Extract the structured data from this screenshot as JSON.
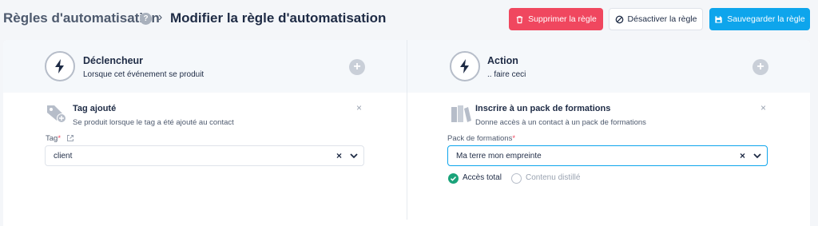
{
  "header": {
    "breadcrumb_parent": "Règles d'automatisation",
    "help_icon_label": "?",
    "page_title": "Modifier la règle d'automatisation",
    "buttons": {
      "delete": "Supprimer la règle",
      "deactivate": "Désactiver la règle",
      "save": "Sauvegarder la règle"
    }
  },
  "trigger": {
    "title": "Déclencheur",
    "subtitle": "Lorsque cet événement se produit",
    "item": {
      "title": "Tag ajouté",
      "subtitle": "Se produit lorsque le tag a été ajouté au contact",
      "field_label": "Tag",
      "field_value": "client"
    }
  },
  "action": {
    "title": "Action",
    "subtitle": ".. faire ceci",
    "item": {
      "title": "Inscrire à un pack de formations",
      "subtitle": "Donne accès à un contact à un pack de formations",
      "field_label": "Pack de formations",
      "field_value": "Ma terre mon empreinte",
      "options": [
        {
          "label": "Accès total",
          "selected": true
        },
        {
          "label": "Contenu distillé",
          "selected": false
        }
      ]
    }
  },
  "common": {
    "required_mark": "*",
    "plus": "+",
    "close": "×",
    "clear": "×"
  },
  "colors": {
    "danger": "#f0475f",
    "primary": "#0ea5ec",
    "success": "#1aa37a",
    "text": "#1e2b45"
  }
}
